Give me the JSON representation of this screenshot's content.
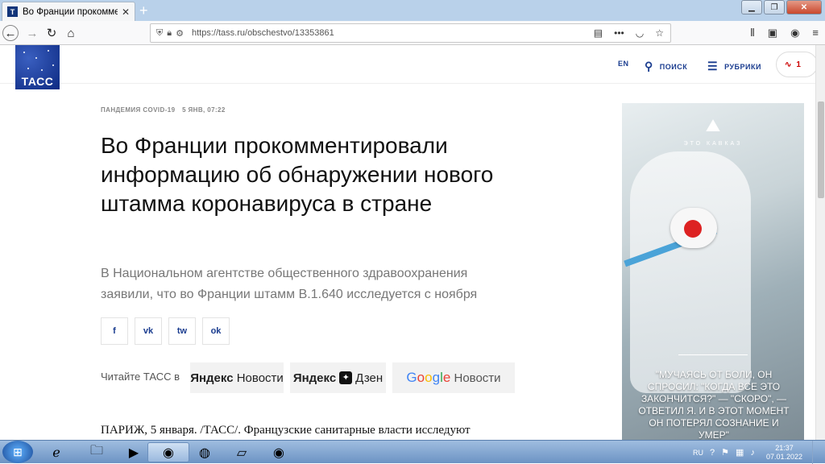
{
  "browser": {
    "tab_title": "Во Франции прокомментиро",
    "url": "https://tass.ru/obschestvo/13353861"
  },
  "site": {
    "logo_text": "ТАСС",
    "nav": {
      "lang": "EN",
      "search": "ПОИСК",
      "rubrics": "РУБРИКИ",
      "live_count": "1"
    }
  },
  "article": {
    "rubric": "ПАНДЕМИЯ COVID-19",
    "date": "5 ЯНВ, 07:22",
    "title": "Во Франции прокомментировали информацию об обнаружении нового штамма коронавируса в стране",
    "lead": "В Национальном агентстве общественного здравоохранения заявили, что во Франции штамм B.1.640 исследуется с ноября",
    "share_buttons": [
      "f",
      "vk",
      "tw",
      "ok"
    ],
    "read_label": "Читайте ТАСС в",
    "aggregators": {
      "yandex_news_brand": "Яндекс",
      "yandex_news_word": "Новости",
      "yandex_zen_brand": "Яндекс",
      "yandex_zen_word": "Дзен",
      "google_word": "Новости"
    },
    "body_start": "ПАРИЖ, 5 января. /ТАСС/. Французские санитарные власти исследуют"
  },
  "ad": {
    "brand": "ЭТО КАВКАЗ",
    "quote": "\"МУЧАЯСЬ ОТ БОЛИ, ОН СПРОСИЛ: \"КОГДА ВСЕ ЭТО ЗАКОНЧИТСЯ?\" — \"СКОРО\", — ОТВЕТИЛ Я. И В ЭТОТ МОМЕНТ ОН ПОТЕРЯЛ СОЗНАНИЕ И УМЕР\""
  },
  "taskbar": {
    "lang": "RU",
    "time": "21:37",
    "date": "07.01.2022"
  }
}
